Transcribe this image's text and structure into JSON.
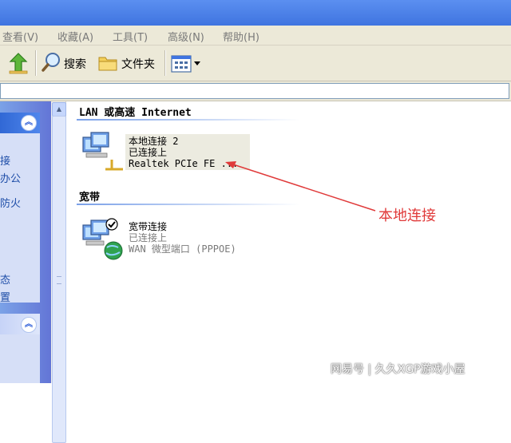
{
  "menu": {
    "items": [
      {
        "label": "查看(V)"
      },
      {
        "label": "收藏(A)"
      },
      {
        "label": "工具(T)"
      },
      {
        "label": "高级(N)"
      },
      {
        "label": "帮助(H)"
      }
    ]
  },
  "toolbar": {
    "search_label": "搜索",
    "folders_label": "文件夹"
  },
  "sidebar": {
    "box1_lines": [
      "接",
      "办公",
      "防火",
      "态",
      "置"
    ]
  },
  "groups": {
    "lan": {
      "header": "LAN 或高速 Internet",
      "item": {
        "name": "本地连接 2",
        "status": "已连接上",
        "device": "Realtek PCIe FE ..."
      }
    },
    "broadband": {
      "header": "宽带",
      "item": {
        "name": "宽带连接",
        "status": "已连接上",
        "device": "WAN 微型端口 (PPPOE)"
      }
    }
  },
  "annotation": {
    "text": "本地连接",
    "color": "#e03a3a"
  },
  "watermark": {
    "text": "网易号 | 久久XGP游戏小屋"
  }
}
